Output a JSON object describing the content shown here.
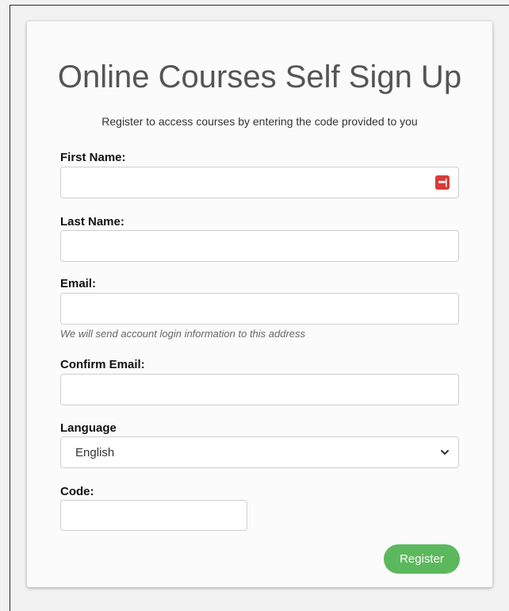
{
  "form": {
    "title": "Online Courses Self Sign Up",
    "subtitle": "Register to access courses by entering the code provided to you",
    "fields": {
      "first_name": {
        "label": "First Name:",
        "value": ""
      },
      "last_name": {
        "label": "Last Name:",
        "value": ""
      },
      "email": {
        "label": "Email:",
        "value": "",
        "hint": "We will send account login information to this address"
      },
      "confirm_email": {
        "label": "Confirm Email:",
        "value": ""
      },
      "language": {
        "label": "Language",
        "selected": "English"
      },
      "code": {
        "label": "Code:",
        "value": ""
      }
    },
    "register_label": "Register",
    "password_manager_icon": "•••|"
  },
  "colors": {
    "highlight_box": "#e6286b",
    "register_button": "#5cb85c",
    "password_manager_icon": "#d93a3a"
  },
  "icons": {
    "password_manager": "password-manager-icon",
    "select_chevron": "chevron-down-icon"
  }
}
